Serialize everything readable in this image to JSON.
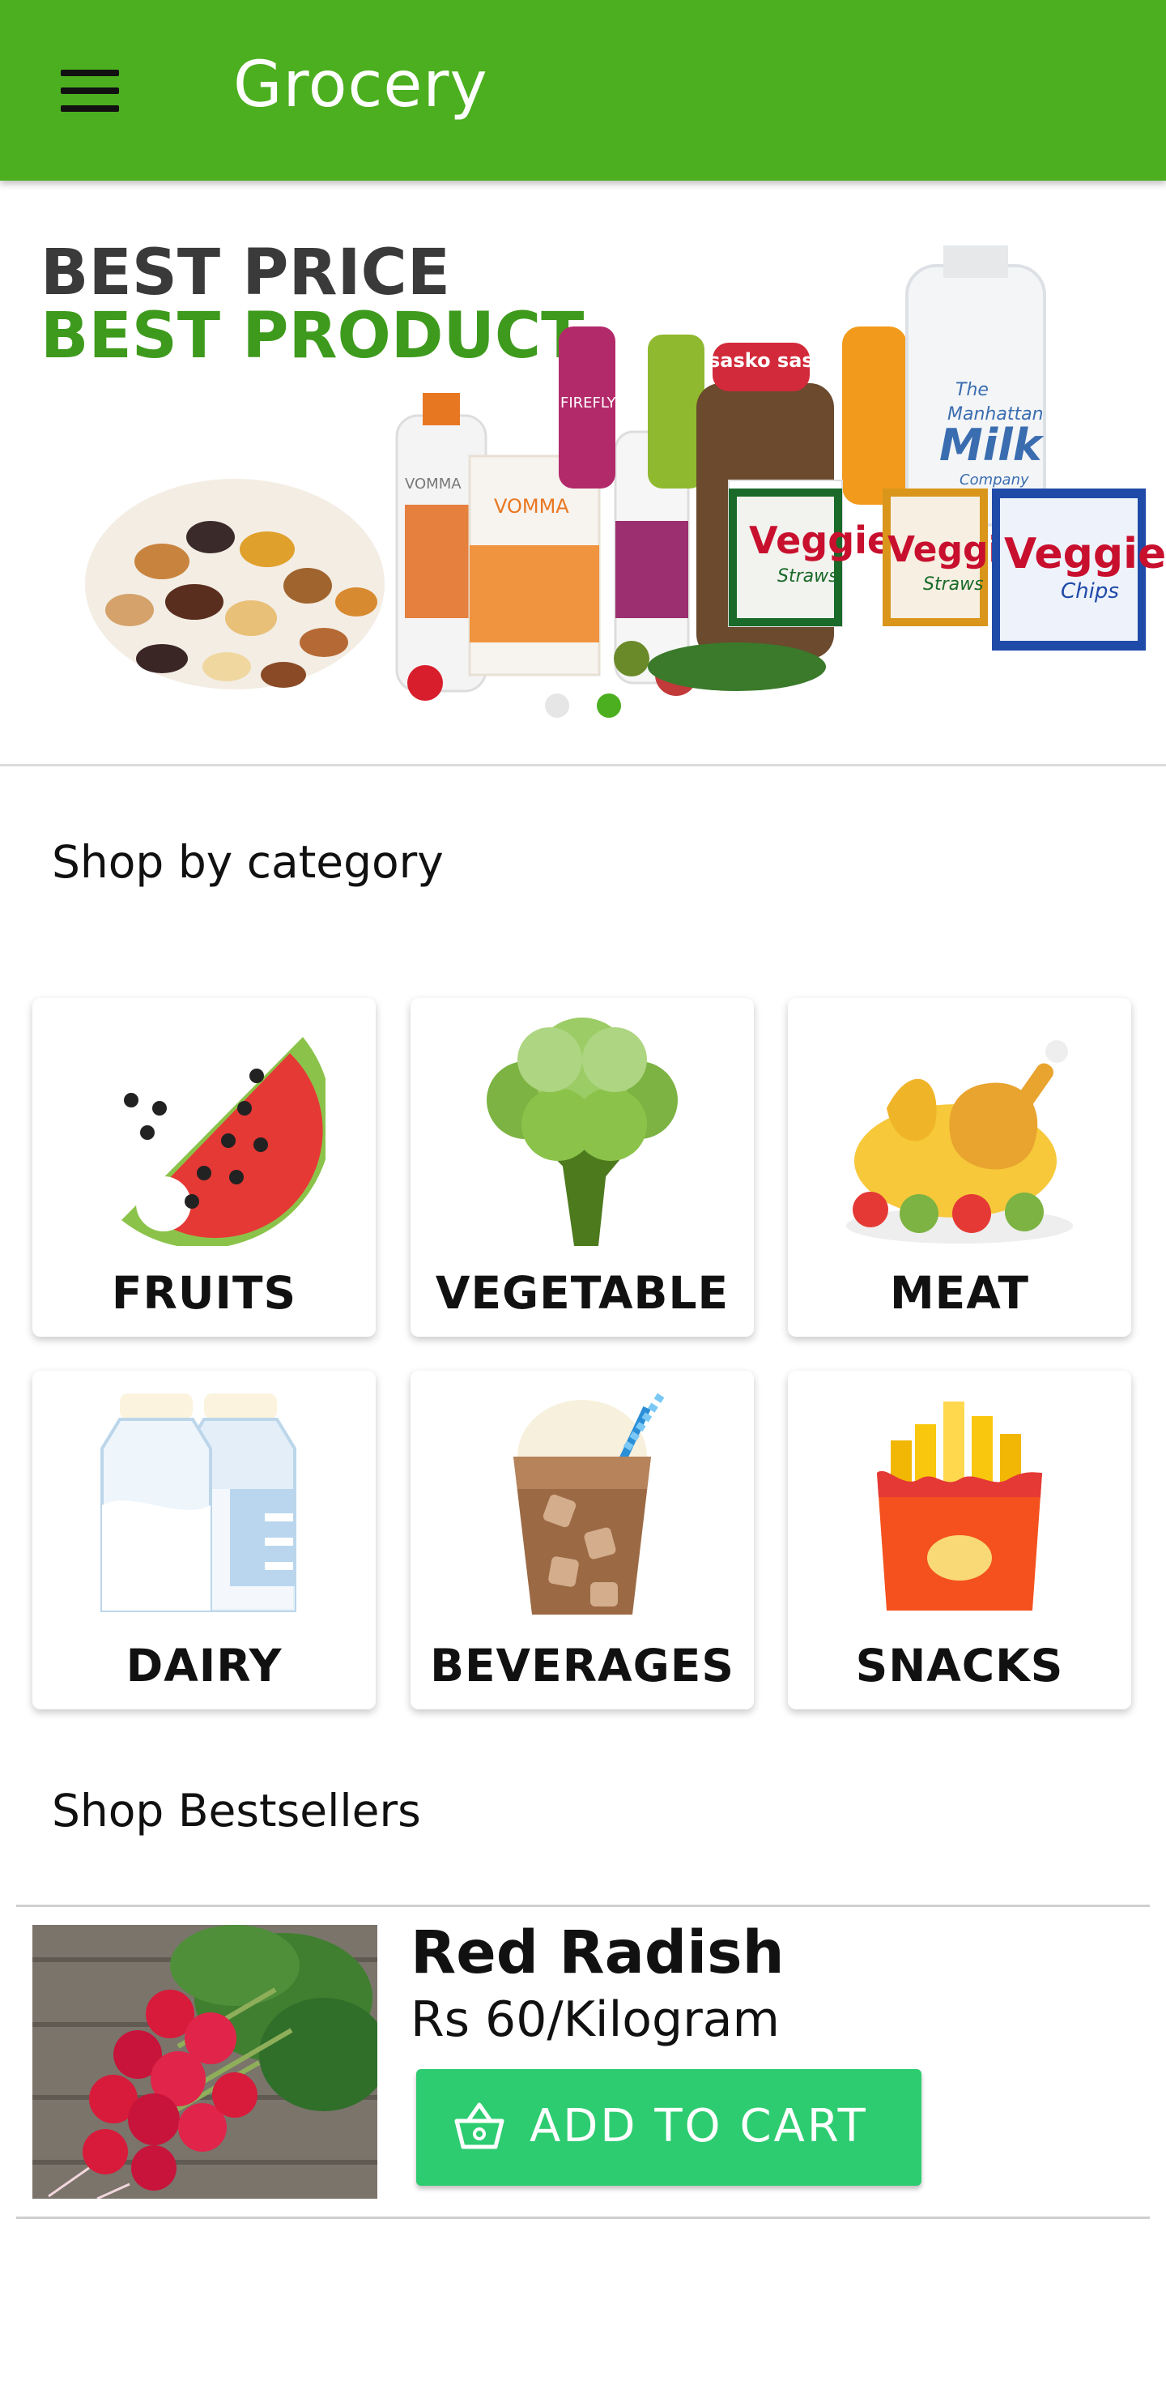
{
  "app_bar": {
    "title": "Grocery",
    "menu_icon": "menu-icon",
    "color": "#4caf1f"
  },
  "banner": {
    "headline_1": "BEST PRICE",
    "headline_2": "BEST PRODUCT",
    "product_texts": {
      "milk_1": "The",
      "milk_2": "Manhattan",
      "milk_3": "Milk",
      "milk_4": "Company",
      "veggie": "Veggie",
      "straws": "Straws",
      "chips": "Chips",
      "vomma": "VOMMA",
      "firefly": "FIREFLY",
      "saskatoon": "sasko sasko"
    },
    "indicator_count": 2,
    "active_indicator": 2
  },
  "categories_section": {
    "title": "Shop by category"
  },
  "categories": [
    {
      "label": "FRUITS",
      "icon": "watermelon-icon"
    },
    {
      "label": "VEGETABLE",
      "icon": "broccoli-icon"
    },
    {
      "label": "MEAT",
      "icon": "roast-chicken-icon"
    },
    {
      "label": "DAIRY",
      "icon": "milk-bottles-icon"
    },
    {
      "label": "BEVERAGES",
      "icon": "iced-drink-icon"
    },
    {
      "label": "SNACKS",
      "icon": "french-fries-icon"
    }
  ],
  "bestsellers_section": {
    "title": "Shop Bestsellers"
  },
  "bestseller": {
    "name": "Red Radish",
    "price": "Rs 60/Kilogram",
    "button_label": "ADD TO CART",
    "button_icon": "basket-icon",
    "button_color": "#2ecc71"
  }
}
